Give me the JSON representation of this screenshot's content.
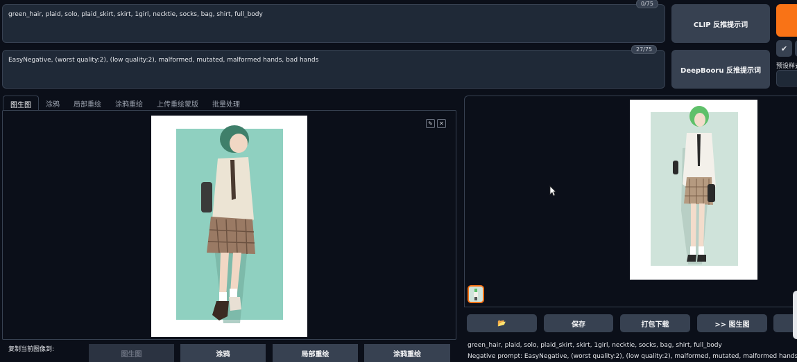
{
  "prompt": {
    "positive": "green_hair, plaid, solo, plaid_skirt, skirt, 1girl, necktie, socks, bag, shirt, full_body",
    "positive_count": "0/75",
    "negative": "EasyNegative, (worst quality:2), (low quality:2), malformed, mutated, malformed hands, bad hands",
    "negative_count": "27/75"
  },
  "interrogate": {
    "clip_label": "CLIP  反推提示词",
    "deepbooru_label": "DeepBooru 反推提示词"
  },
  "side": {
    "check_glyph": "✔",
    "style_label": "预设样式"
  },
  "tabs": [
    "图生图",
    "涂鸦",
    "局部重绘",
    "涂鸦重绘",
    "上传重绘蒙版",
    "批量处理"
  ],
  "tools": {
    "edit_glyph": "✎",
    "close_glyph": "✕"
  },
  "copy": {
    "label": "复制当前图像到:",
    "buttons": [
      "图生图",
      "涂鸦",
      "局部重绘",
      "涂鸦重绘"
    ]
  },
  "output": {
    "buttons": [
      "📂",
      "保存",
      "打包下载",
      ">> 图生图"
    ],
    "info_prompt": "green_hair, plaid, solo, plaid_skirt, skirt, 1girl, necktie, socks, bag, shirt, full_body",
    "info_negative": "Negative prompt: EasyNegative, (worst quality:2), (low quality:2), malformed, mutated, malformed hands, bad hands"
  },
  "colors": {
    "accent": "#f97316",
    "bg": "#0b0f19",
    "panel": "#1f2937",
    "button": "#374151"
  }
}
